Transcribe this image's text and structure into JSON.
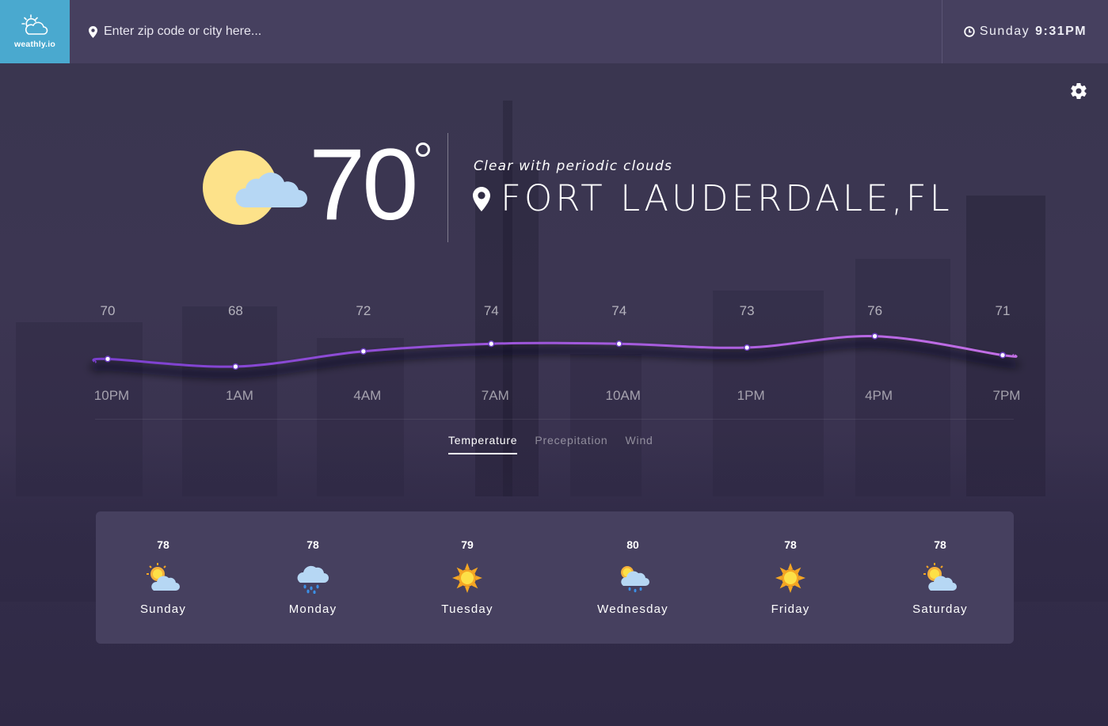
{
  "app": {
    "logo_text": "weathly.io"
  },
  "search": {
    "placeholder": "Enter zip code or city here..."
  },
  "clock": {
    "day": "Sunday",
    "time": "9:31PM"
  },
  "current": {
    "temperature": "70",
    "condition": "Clear with periodic clouds",
    "location": "FORT LAUDERDALE,FL",
    "icon": "partly-cloudy-icon"
  },
  "chart_data": {
    "type": "line",
    "categories": [
      "10PM",
      "1AM",
      "4AM",
      "7AM",
      "10AM",
      "1PM",
      "4PM",
      "7PM"
    ],
    "values": [
      70,
      68,
      72,
      74,
      74,
      73,
      76,
      71
    ],
    "title": "",
    "xlabel": "",
    "ylabel": "",
    "grid": false,
    "colors": {
      "start": "#7b3fd0",
      "end": "#c36fe6"
    }
  },
  "tabs": [
    {
      "label": "Temperature",
      "active": true
    },
    {
      "label": "Precepitation",
      "active": false
    },
    {
      "label": "Wind",
      "active": false
    }
  ],
  "forecast": [
    {
      "temp": "78",
      "day": "Sunday",
      "icon": "partly-cloudy-icon"
    },
    {
      "temp": "78",
      "day": "Monday",
      "icon": "rain-icon"
    },
    {
      "temp": "79",
      "day": "Tuesday",
      "icon": "sun-icon"
    },
    {
      "temp": "80",
      "day": "Wednesday",
      "icon": "sun-rain-icon"
    },
    {
      "temp": "78",
      "day": "Friday",
      "icon": "sun-icon"
    },
    {
      "temp": "78",
      "day": "Saturday",
      "icon": "partly-cloudy-icon"
    }
  ],
  "colors": {
    "topbar": "#46405f",
    "logo_bg": "#4aa9cf",
    "background": "#2f2a45",
    "card": "#46405f"
  }
}
